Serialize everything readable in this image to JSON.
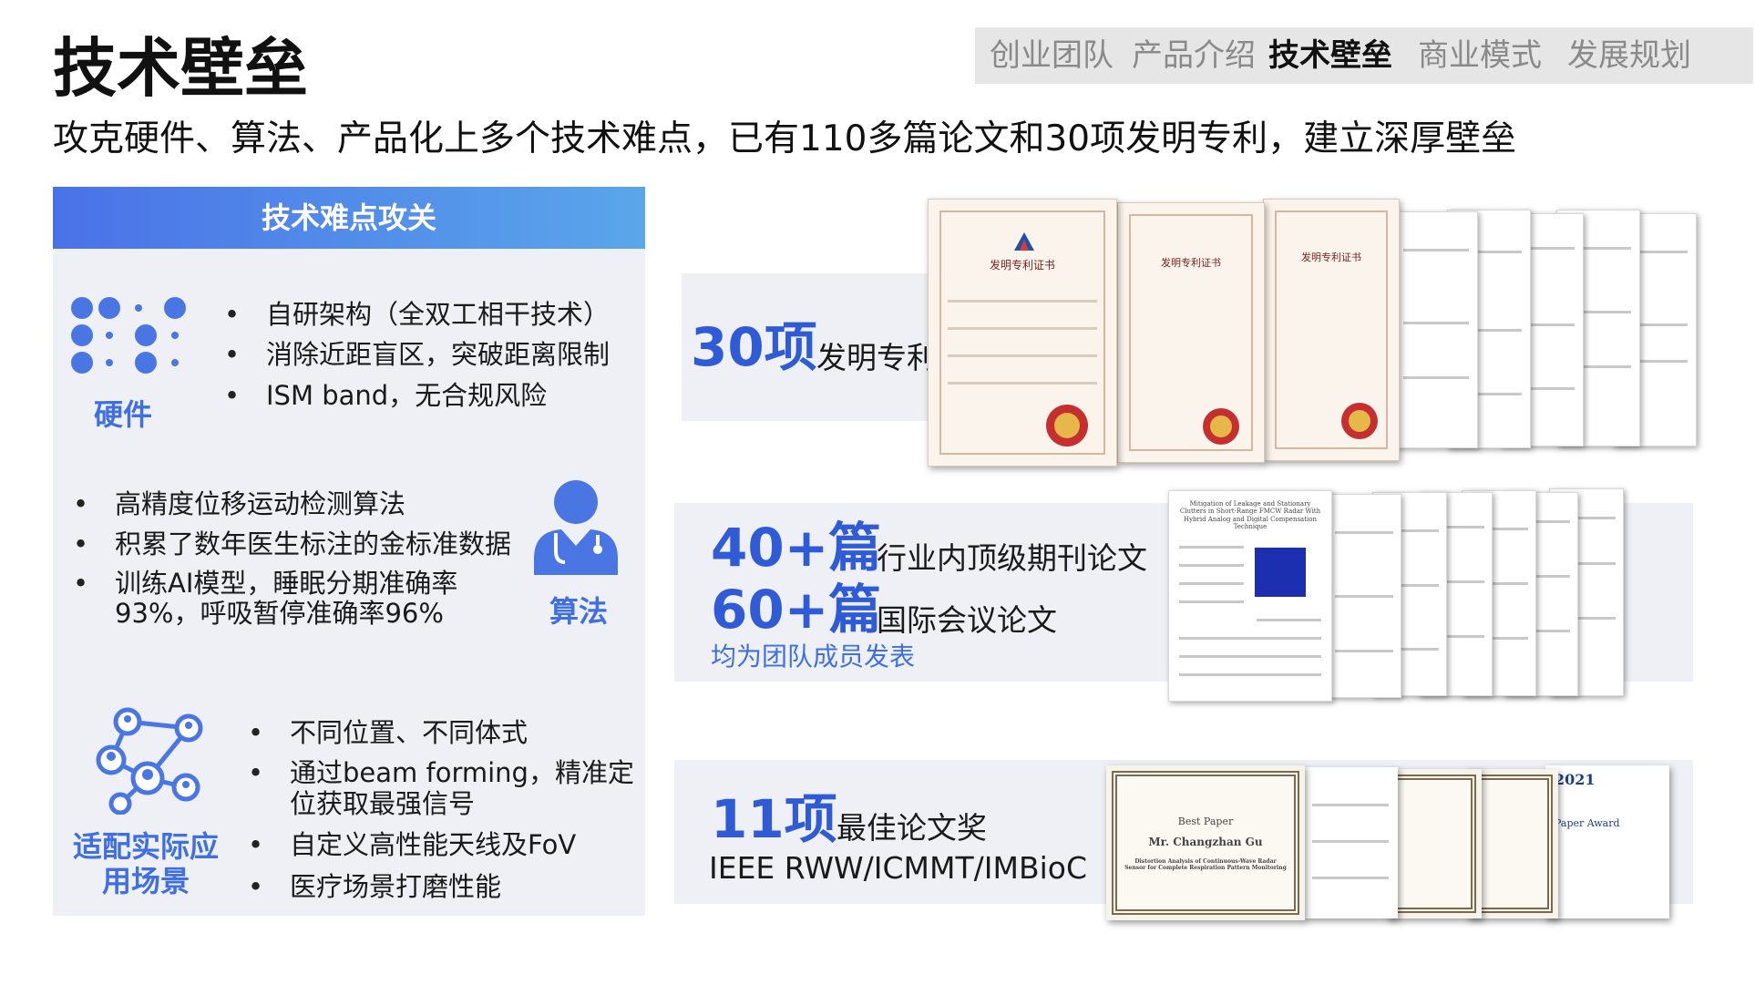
{
  "page": {
    "title": "技术壁垒",
    "subtitle": "攻克硬件、算法、产品化上多个技术难点，已有110多篇论文和30项发明专利，建立深厚壁垒"
  },
  "nav": {
    "items": [
      "创业团队",
      "产品介绍",
      "技术壁垒",
      "商业模式",
      "发展规划"
    ],
    "active_index": 2
  },
  "panel": {
    "header": "技术难点攻关",
    "hardware": {
      "label": "硬件",
      "icon": "dots-grid-icon",
      "items": [
        "自研架构（全双工相干技术）",
        "消除近距盲区，突破距离限制",
        "ISM band，无合规风险"
      ]
    },
    "algorithm": {
      "label": "算法",
      "icon": "doctor-icon",
      "items": [
        "高精度位移运动检测算法",
        "积累了数年医生标注的金标准数据",
        "训练AI模型，睡眠分期准确率93%，呼吸暂停准确率96%"
      ]
    },
    "scenario": {
      "label": "适配实际应用场景",
      "icon": "network-people-icon",
      "items": [
        "不同位置、不同体式",
        "通过beam forming，精准定位获取最强信号",
        "自定义高性能天线及FoV",
        "医疗场景打磨性能"
      ]
    }
  },
  "patents": {
    "number": "30项",
    "label": "发明专利",
    "cert_title": "发明专利证书"
  },
  "papers": {
    "journal_number": "40+篇",
    "journal_label": "行业内顶级期刊论文",
    "conf_number": "60+篇",
    "conf_label": "国际会议论文",
    "note": "均为团队成员发表",
    "paper_title": "Mitigation of Leakage and Stationary Clutters in Short-Range FMCW Radar With Hybrid Analog and Digital Compensation Technique"
  },
  "awards": {
    "number": "11项",
    "label": "最佳论文奖",
    "venues": "IEEE RWW/ICMMT/IMBioC",
    "award_heading": "Best Paper",
    "award_name": "Mr. Changzhan Gu",
    "award_desc": "Distortion Analysis of Continuous-Wave Radar Sensor for Complete Respiration Pattern Monitoring",
    "award_2021": "2021",
    "award_2021_text": "Paper Award"
  },
  "colors": {
    "accent": "#2f5cd6",
    "label_blue": "#3f6fe0",
    "panel_bg": "#eef0f6",
    "nav_bg": "#e6e6e6"
  }
}
